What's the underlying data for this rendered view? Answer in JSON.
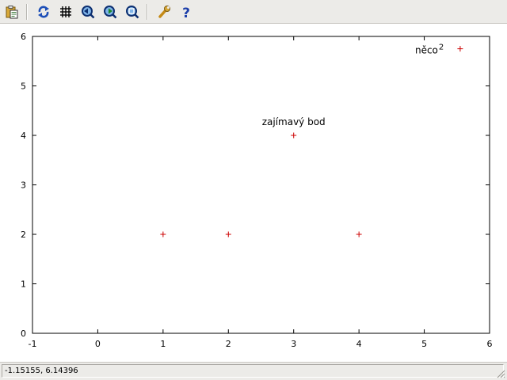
{
  "toolbar": {
    "buttons": [
      {
        "name": "copy-to-clipboard-icon"
      },
      {
        "name": "replot-icon"
      },
      {
        "name": "grid-icon"
      },
      {
        "name": "zoom-previous-icon"
      },
      {
        "name": "zoom-next-icon"
      },
      {
        "name": "unzoom-icon"
      },
      {
        "name": "options-icon"
      },
      {
        "name": "help-icon"
      }
    ]
  },
  "status": {
    "coordinates": "-1.15155,  6.14396"
  },
  "chart_data": {
    "type": "scatter",
    "title": "",
    "xlabel": "",
    "ylabel": "",
    "xlim": [
      -1,
      6
    ],
    "ylim": [
      0,
      6
    ],
    "xticks": [
      "-1",
      "0",
      "1",
      "2",
      "3",
      "4",
      "5",
      "6"
    ],
    "yticks": [
      "0",
      "1",
      "2",
      "3",
      "4",
      "5",
      "6"
    ],
    "grid": false,
    "marker_color": "#cc0000",
    "marker": "plus",
    "points": [
      {
        "x": 1,
        "y": 2
      },
      {
        "x": 2,
        "y": 2
      },
      {
        "x": 3,
        "y": 4
      },
      {
        "x": 4,
        "y": 2
      },
      {
        "x": 5.55,
        "y": 5.75
      }
    ],
    "annotations": [
      {
        "text": "zajímavý bod",
        "x": 3,
        "y": 4
      },
      {
        "text": "něco",
        "sup": "2",
        "x": 5.55,
        "y": 5.75
      }
    ]
  }
}
